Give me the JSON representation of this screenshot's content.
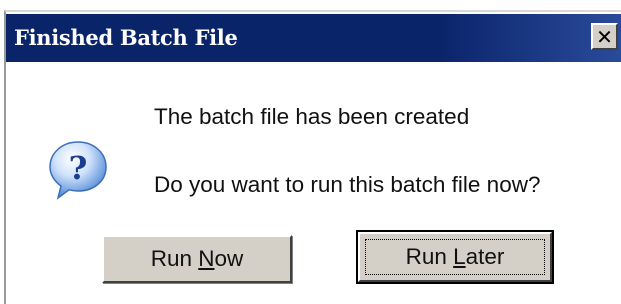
{
  "window": {
    "title": "Finished Batch File",
    "close_glyph": "✕"
  },
  "message": {
    "line1": "The batch file has been created",
    "line2": "Do you want to run this batch file now?",
    "icon": "question-icon"
  },
  "buttons": {
    "run_now": {
      "pre": "Run ",
      "mnemonic": "N",
      "post": "ow"
    },
    "run_later": {
      "pre": "Run ",
      "mnemonic": "L",
      "post": "ater"
    }
  },
  "colors": {
    "titlebar": "#0a246a",
    "button_face": "#d4d0c8",
    "icon_blue": "#2f6fc6"
  }
}
